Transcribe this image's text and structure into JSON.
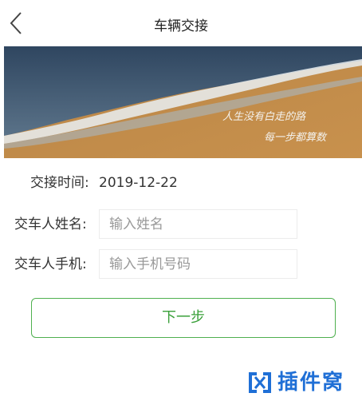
{
  "header": {
    "title": "车辆交接",
    "back_icon": "chevron-left-icon"
  },
  "banner": {
    "poem_line1": "人生没有白走的路",
    "poem_line2": "每一步都算数"
  },
  "form": {
    "handover_time_label": "交接时间:",
    "handover_time_value": "2019-12-22",
    "name_label": "交车人姓名:",
    "name_placeholder": "输入姓名",
    "phone_label": "交车人手机:",
    "phone_placeholder": "输入手机号码"
  },
  "actions": {
    "next_label": "下一步"
  },
  "watermark": {
    "text": "插件窝"
  },
  "colors": {
    "accent_green": "#3aa03a",
    "watermark_blue": "#1f6fd6"
  }
}
